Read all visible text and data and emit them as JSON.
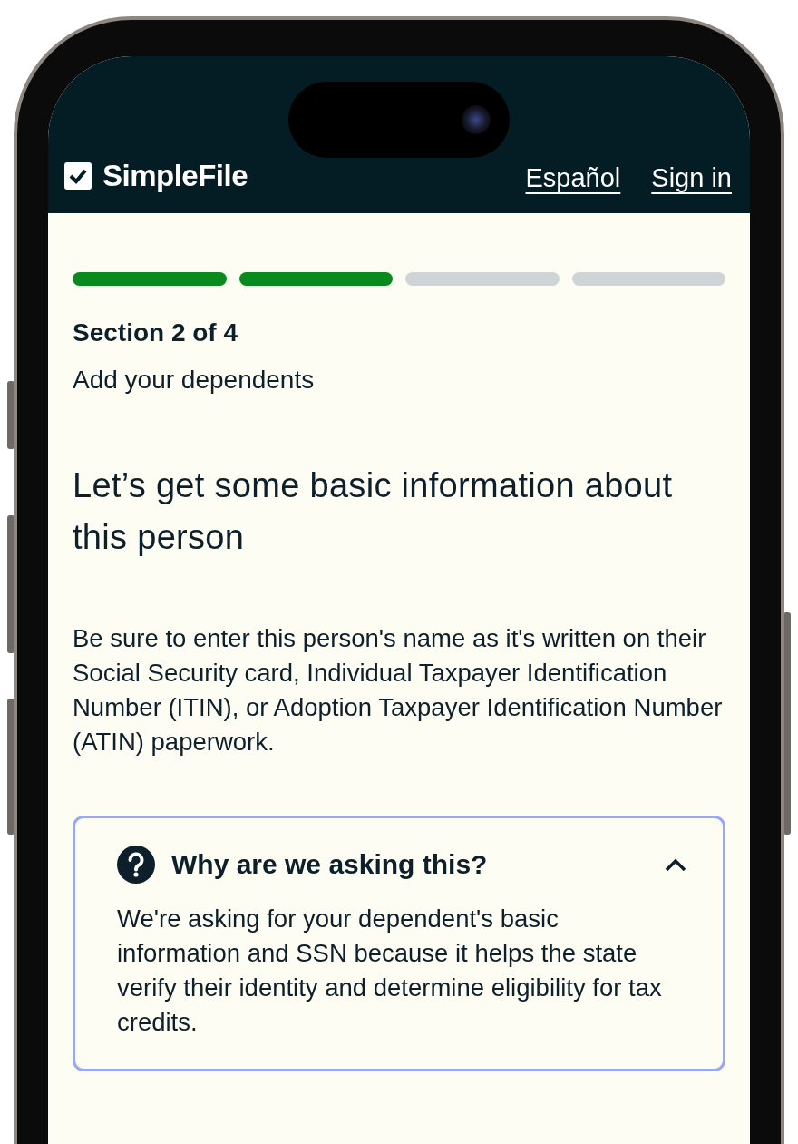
{
  "header": {
    "logo": "SimpleFile",
    "links": [
      "Español",
      "Sign in"
    ]
  },
  "progress": [
    {
      "complete": true
    },
    {
      "complete": true
    },
    {
      "complete": false
    },
    {
      "complete": false
    }
  ],
  "section": "Section 2 of 4",
  "subtitle": "Add your dependents",
  "heading": "Let’s get some basic information about this person",
  "intro": "Be sure to enter this person's name as it's written on their Social Security card, Individual Taxpayer Identification Number (ITIN), or Adoption Taxpayer Identification Number (ATIN) paperwork.",
  "help": {
    "title": "Why are we asking this?",
    "expanded": true,
    "body": "We're asking for your dependent's basic information and SSN because it helps the state verify their identity and determine eligibility for tax credits."
  }
}
